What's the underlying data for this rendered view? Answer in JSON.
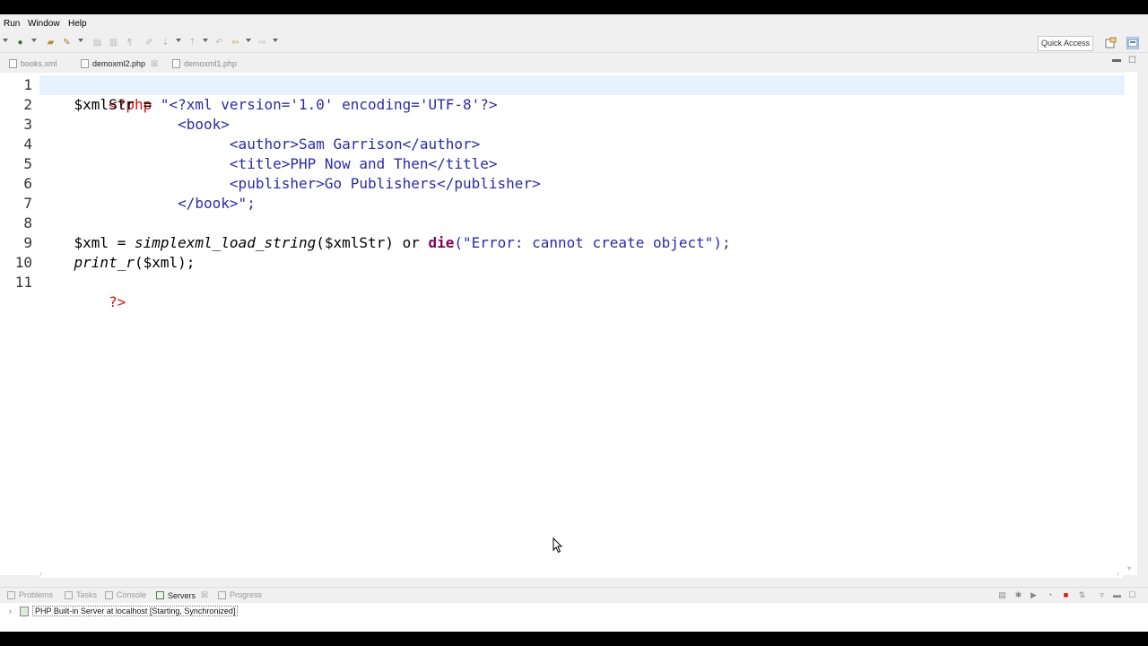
{
  "menu": {
    "items": [
      "Run",
      "Window",
      "Help"
    ]
  },
  "toolbar": {
    "quick_access": "Quick Access"
  },
  "editor_tabs": [
    {
      "label": "books.xml"
    },
    {
      "label": "demoxml2.php"
    },
    {
      "label": "demoxml1.php"
    }
  ],
  "editor": {
    "active_tab": "demoxml2.php",
    "line_numbers": [
      "1",
      "2",
      "3",
      "4",
      "5",
      "6",
      "7",
      "8",
      "9",
      "10",
      "11"
    ],
    "code": {
      "l1_open": "<?php",
      "l2_var": "    $xmlStr = ",
      "l2_str": "\"<?xml version='1.0' encoding='UTF-8'?>",
      "l3": "                <book>",
      "l4": "                      <author>Sam Garrison</author>",
      "l5": "                      <title>PHP Now and Then</title>",
      "l6": "                      <publisher>Go Publishers</publisher>",
      "l7": "                </book>\";",
      "l9_var": "    $xml = ",
      "l9_fn": "simplexml_load_string",
      "l9_args": "($xmlStr) or ",
      "l9_kw": "die",
      "l9_str": "(\"Error: cannot create object\");",
      "l10_fn": "    print_r",
      "l10_rest": "($xml);",
      "l11_close": "?>"
    }
  },
  "bottom_panel": {
    "tabs": [
      {
        "label": "Problems"
      },
      {
        "label": "Tasks"
      },
      {
        "label": "Console"
      },
      {
        "label": "Servers"
      },
      {
        "label": "Progress"
      }
    ],
    "active_tab": "Servers",
    "server_row": "PHP Built-in Server at localhost  [Starting, Synchronized]"
  },
  "colors": {
    "php_tag": "#d01010",
    "string": "#2a2aa8",
    "keyword": "#7f0055",
    "current_line": "#e8f2fe"
  }
}
